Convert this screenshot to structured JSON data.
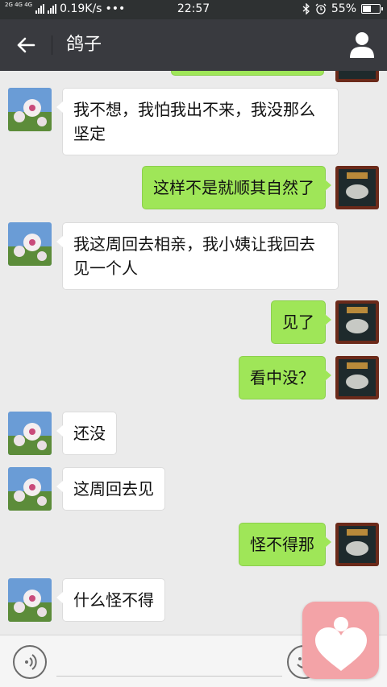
{
  "status_bar": {
    "net_tags": "2G 4G 4G",
    "speed": "0.19K/s",
    "dots": "•••",
    "time": "22:57",
    "battery": "55%",
    "battery_level": 0.55,
    "icons": [
      "signal-icon",
      "bluetooth-icon",
      "alarm-icon",
      "battery-icon"
    ]
  },
  "header": {
    "title": "鸽子",
    "icons": [
      "back-arrow-icon",
      "person-icon"
    ]
  },
  "messages": [
    {
      "side": "in",
      "text": "我不想，我怕我出不来，我没那么坚定"
    },
    {
      "side": "out",
      "text": "这样不是就顺其自然了"
    },
    {
      "side": "in",
      "text": "我这周回去相亲，我小姨让我回去见一个人"
    },
    {
      "side": "out",
      "text": "见了"
    },
    {
      "side": "out",
      "text": "看中没？"
    },
    {
      "side": "in",
      "text": "还没"
    },
    {
      "side": "in",
      "text": "这周回去见"
    },
    {
      "side": "out",
      "text": "怪不得那"
    },
    {
      "side": "in",
      "text": "什么怪不得"
    }
  ],
  "bottom_bar": {
    "icons": [
      "voice-icon",
      "emoji-icon"
    ]
  },
  "floating_widget": {
    "icon": "heart-person-icon"
  },
  "colors": {
    "header_bg": "#393a3f",
    "chat_bg": "#ebebeb",
    "bubble_out": "#9fe658",
    "bubble_in": "#ffffff",
    "widget": "#f3a3a7"
  }
}
